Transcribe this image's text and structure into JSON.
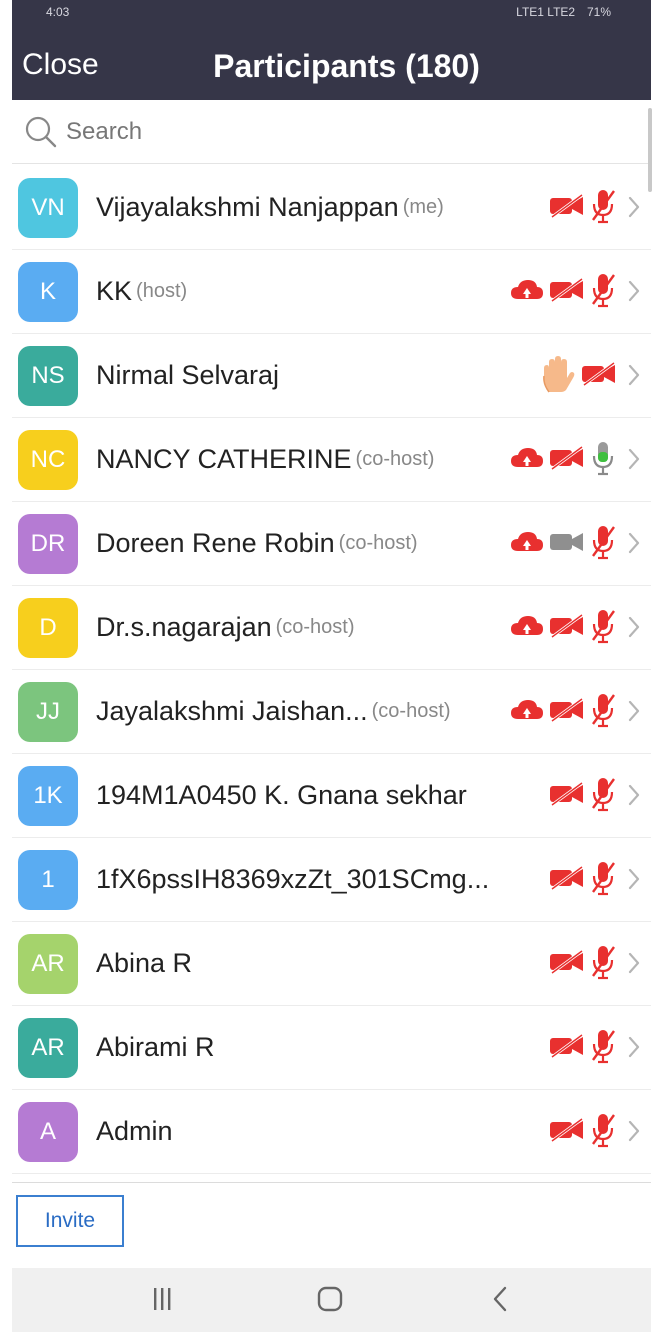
{
  "status": {
    "time": "4:03",
    "battery": "71%",
    "network": "LTE1 LTE2"
  },
  "header": {
    "close_label": "Close",
    "title": "Participants (180)"
  },
  "search": {
    "placeholder": "Search"
  },
  "participants": [
    {
      "initials": "VN",
      "name": "Vijayalakshmi Nanjappan",
      "tag": "(me)",
      "color": "#4fc6e0",
      "icons": [
        "video-off",
        "mic-off"
      ]
    },
    {
      "initials": "K",
      "name": "KK",
      "tag": "(host)",
      "color": "#5aacf2",
      "icons": [
        "cloud",
        "video-off",
        "mic-off"
      ]
    },
    {
      "initials": "NS",
      "name": "Nirmal Selvaraj",
      "tag": "",
      "color": "#3aab9c",
      "icons": [
        "hand",
        "video-off"
      ]
    },
    {
      "initials": "NC",
      "name": "NANCY CATHERINE",
      "tag": "(co-host)",
      "color": "#f7cf1d",
      "icons": [
        "cloud",
        "video-off",
        "mic-on"
      ]
    },
    {
      "initials": "DR",
      "name": "Doreen Rene Robin",
      "tag": "(co-host)",
      "color": "#b57bd3",
      "icons": [
        "cloud",
        "video-on",
        "mic-off"
      ]
    },
    {
      "initials": "D",
      "name": "Dr.s.nagarajan",
      "tag": "(co-host)",
      "color": "#f7cf1d",
      "icons": [
        "cloud",
        "video-off",
        "mic-off"
      ]
    },
    {
      "initials": "JJ",
      "name": "Jayalakshmi Jaishan...",
      "tag": "(co-host)",
      "color": "#7cc57e",
      "icons": [
        "cloud",
        "video-off",
        "mic-off"
      ]
    },
    {
      "initials": "1K",
      "name": "194M1A0450 K. Gnana sekhar",
      "tag": "",
      "color": "#5aacf2",
      "icons": [
        "video-off",
        "mic-off"
      ]
    },
    {
      "initials": "1",
      "name": "1fX6pssIH8369xzZt_301SCmg...",
      "tag": "",
      "color": "#5aacf2",
      "icons": [
        "video-off",
        "mic-off"
      ]
    },
    {
      "initials": "AR",
      "name": "Abina R",
      "tag": "",
      "color": "#a5d36c",
      "icons": [
        "video-off",
        "mic-off"
      ]
    },
    {
      "initials": "AR",
      "name": "Abirami R",
      "tag": "",
      "color": "#3aab9c",
      "icons": [
        "video-off",
        "mic-off"
      ]
    },
    {
      "initials": "A",
      "name": "Admin",
      "tag": "",
      "color": "#b57bd3",
      "icons": [
        "video-off",
        "mic-off"
      ]
    }
  ],
  "footer": {
    "invite_label": "Invite"
  }
}
